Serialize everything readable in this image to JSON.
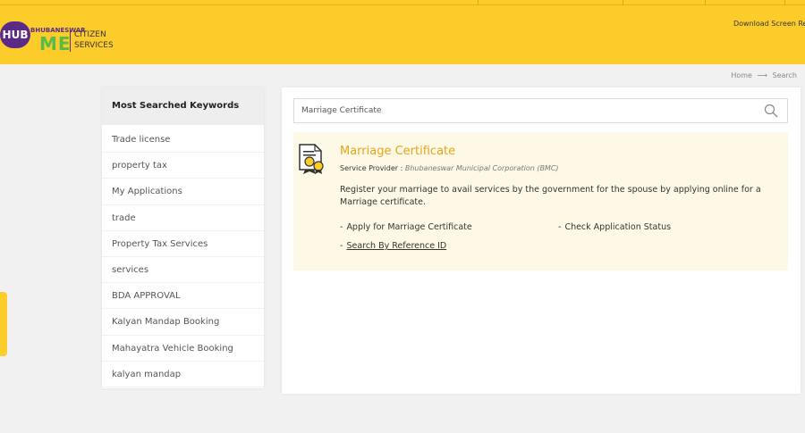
{
  "header": {
    "logo_hub": "HUB",
    "logo_bhub": "BHUBANESWAR",
    "logo_me": "ME",
    "logo_citizen_line1": "CITIZEN",
    "logo_citizen_line2": "SERVICES",
    "download_label": "Download Screen Reader",
    "brand_color": "#fccd2a"
  },
  "breadcrumb": {
    "home": "Home",
    "arrow": "⟶",
    "current": "Search"
  },
  "keywords": {
    "heading": "Most Searched Keywords",
    "items": [
      "Trade license",
      "property tax",
      "My Applications",
      "trade",
      "Property Tax Services",
      "services",
      "BDA APPROVAL",
      "Kalyan Mandap Booking",
      "Mahayatra Vehicle Booking",
      "kalyan mandap"
    ]
  },
  "search": {
    "value": "Marriage Certificate",
    "icon": "search-icon"
  },
  "result": {
    "title": "Marriage Certificate",
    "provider_label": "Service Provider :",
    "provider_value": "Bhubaneswar Municipal Corporation (BMC)",
    "description": "Register your marriage to avail services by the government for the spouse by applying online for a Marriage certificate.",
    "links": {
      "apply": "Apply for Marriage Certificate",
      "status": "Check Application Status",
      "reference": "Search By Reference ID"
    },
    "dash": "-",
    "icon": "certificate-icon",
    "accent_color": "#e3a51b"
  }
}
